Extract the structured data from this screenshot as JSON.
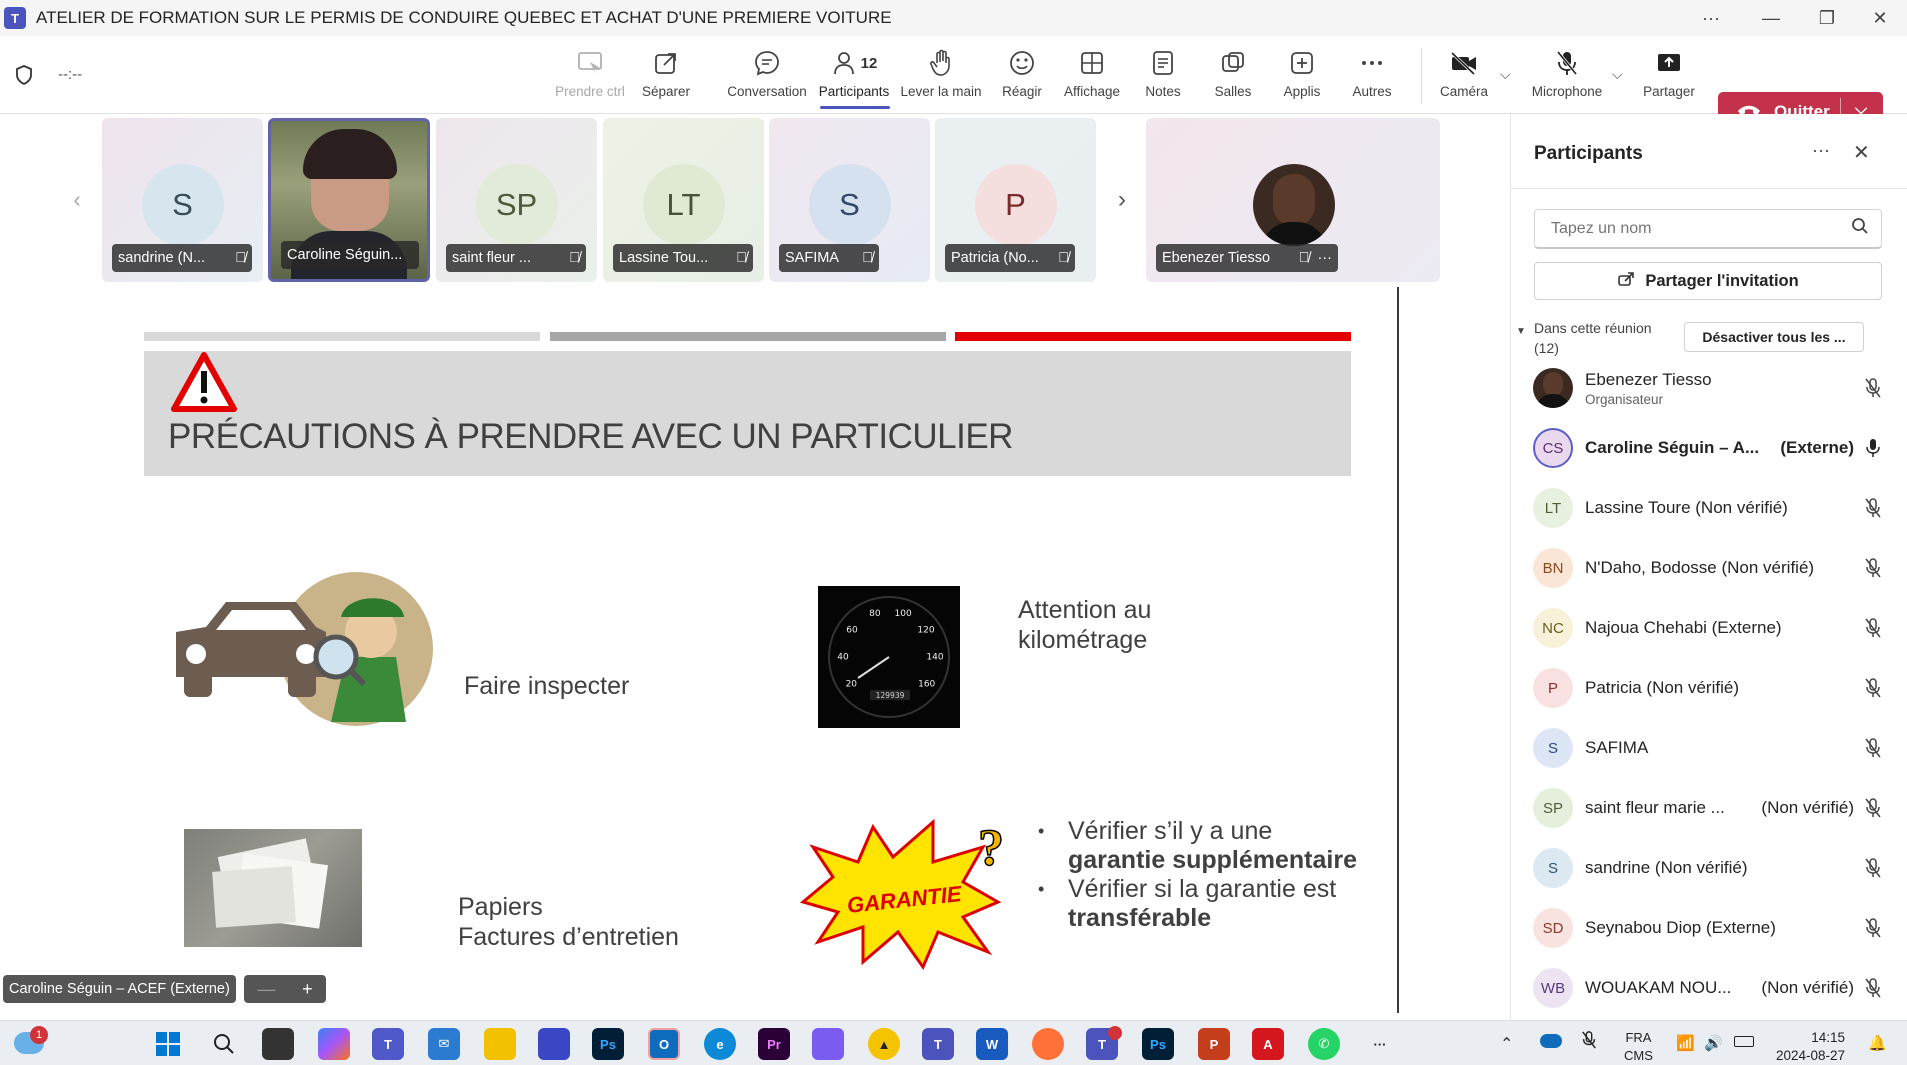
{
  "window": {
    "title": "ATELIER DE FORMATION SUR LE PERMIS DE CONDUIRE QUEBEC ET ACHAT D'UNE PREMIERE VOITURE"
  },
  "meeting": {
    "timer": "--:--"
  },
  "toolbar": {
    "take_control": "Prendre ctrl",
    "separate": "Séparer",
    "chat": "Conversation",
    "participants": "Participants",
    "participants_count": "12",
    "raise_hand": "Lever la main",
    "react": "Réagir",
    "view": "Affichage",
    "notes": "Notes",
    "rooms": "Salles",
    "apps": "Applis",
    "more": "Autres",
    "camera": "Caméra",
    "microphone": "Microphone",
    "share": "Partager",
    "leave": "Quitter"
  },
  "gallery": [
    {
      "initials": "S",
      "name": "sandrine (N..."
    },
    {
      "initials": "",
      "name": "Caroline Séguin..."
    },
    {
      "initials": "SP",
      "name": "saint fleur ..."
    },
    {
      "initials": "LT",
      "name": "Lassine Tou..."
    },
    {
      "initials": "S",
      "name": "SAFIMA"
    },
    {
      "initials": "P",
      "name": "Patricia (No..."
    },
    {
      "initials": "",
      "name": "Ebenezer Tiesso"
    }
  ],
  "slide": {
    "title": "PRÉCAUTIONS À PRENDRE AVEC UN PARTICULIER",
    "inspect": "Faire inspecter",
    "mileage_line1": "Attention au",
    "mileage_line2": "kilométrage",
    "papers_line1": "Papiers",
    "papers_line2": "Factures d’entretien",
    "warranty_badge": "GARANTIE",
    "odometer": "129939",
    "bullet1_a": "Vérifier s’il y a une",
    "bullet1_b": "garantie supplémentaire",
    "bullet2_a": "Vérifier si la garantie est",
    "bullet2_b": "transférable",
    "speedo_ticks": [
      "20",
      "40",
      "60",
      "80",
      "100",
      "120",
      "140",
      "160"
    ]
  },
  "presenter_tag": "Caroline Séguin – ACEF (Externe)",
  "zoom": {
    "minus": "—",
    "plus": "+"
  },
  "panel": {
    "title": "Participants",
    "search_placeholder": "Tapez un nom",
    "share_invite": "Partager l'invitation",
    "section_line1": "Dans cette réunion",
    "section_line2": "(12)",
    "mute_all": "Désactiver tous les ...",
    "people": [
      {
        "initials": "",
        "name": "Ebenezer Tiesso",
        "role": "Organisateur",
        "tag": ""
      },
      {
        "initials": "CS",
        "name": "Caroline Séguin – A...",
        "role": "",
        "tag": "(Externe)"
      },
      {
        "initials": "LT",
        "name": "Lassine Toure (Non vérifié)",
        "role": "",
        "tag": ""
      },
      {
        "initials": "BN",
        "name": "N'Daho, Bodosse (Non vérifié)",
        "role": "",
        "tag": ""
      },
      {
        "initials": "NC",
        "name": "Najoua Chehabi (Externe)",
        "role": "",
        "tag": ""
      },
      {
        "initials": "P",
        "name": "Patricia (Non vérifié)",
        "role": "",
        "tag": ""
      },
      {
        "initials": "S",
        "name": "SAFIMA",
        "role": "",
        "tag": ""
      },
      {
        "initials": "SP",
        "name": "saint fleur marie ...",
        "role": "",
        "tag": "(Non vérifié)"
      },
      {
        "initials": "S",
        "name": "sandrine (Non vérifié)",
        "role": "",
        "tag": ""
      },
      {
        "initials": "SD",
        "name": "Seynabou Diop (Externe)",
        "role": "",
        "tag": ""
      },
      {
        "initials": "WB",
        "name": "WOUAKAM NOU...",
        "role": "",
        "tag": "(Non vérifié)"
      }
    ]
  },
  "taskbar": {
    "weather_badge": "1",
    "lang1": "FRA",
    "lang2": "CMS",
    "time": "14:15",
    "date": "2024-08-27"
  },
  "colors": {
    "accent": "#4b53bc",
    "leave": "#c4314b",
    "slide_red": "#e30000"
  }
}
